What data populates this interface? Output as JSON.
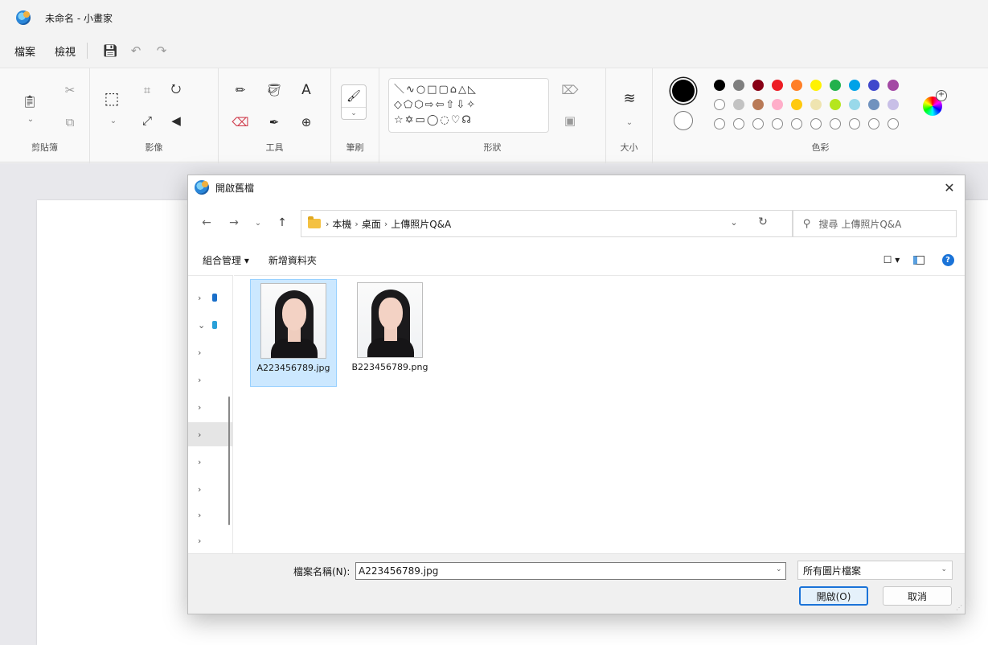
{
  "app": {
    "title": "未命名 - 小畫家",
    "menu": [
      "檔案",
      "檢視"
    ]
  },
  "ribbon": {
    "groups": [
      "剪貼簿",
      "影像",
      "工具",
      "筆刷",
      "形狀",
      "大小",
      "色彩"
    ],
    "shapes_rows": [
      "＼∿○□▢⌂△◺",
      "◇⬠⬡⇨⇦⇧⇩✧",
      "☆✡▭◯◌♡☊"
    ],
    "palette_row1": [
      "#000000",
      "#7f7f7f",
      "#880015",
      "#ed1c24",
      "#ff7f27",
      "#fff200",
      "#22b14c",
      "#00a2e8",
      "#3f48cc",
      "#a349a4"
    ],
    "palette_row2": [
      "",
      "#c3c3c3",
      "#b97a57",
      "#ffaec9",
      "#ffc90e",
      "#efe4b0",
      "#b5e61d",
      "#99d9ea",
      "#7092be",
      "#c8bfe7"
    ],
    "primary_color": "#000000",
    "secondary_color": "#ffffff"
  },
  "dialog": {
    "title": "開啟舊檔",
    "breadcrumb": [
      "本機",
      "桌面",
      "上傳照片Q&A"
    ],
    "search_placeholder": "搜尋 上傳照片Q&A",
    "commands": [
      "組合管理 ▾",
      "新增資料夾"
    ],
    "files": [
      {
        "name": "A223456789.jpg",
        "selected": true
      },
      {
        "name": "B223456789.png",
        "selected": false
      }
    ],
    "filename_label": "檔案名稱(N):",
    "filename_value": "A223456789.jpg",
    "filetype": "所有圖片檔案",
    "open_button": "開啟(O)",
    "cancel_button": "取消"
  }
}
